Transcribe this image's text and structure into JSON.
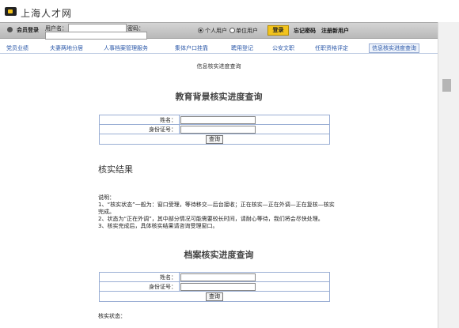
{
  "header": {
    "site_name": "上海人才网"
  },
  "login_bar": {
    "member_login": "会员登录",
    "username_label": "用户名：",
    "password_label": "密码：",
    "personal_user": "个人用户",
    "unit_user": "单位用户",
    "login_button": "登录",
    "forgot_password": "忘记密码",
    "register": "注册新用户",
    "selected_user_type": "个人用户"
  },
  "nav": {
    "items": [
      "党员业绩",
      "夫妻两地分居",
      "人事档案管理服务",
      "集体户口挂靠",
      "聘用登记",
      "公安文职",
      "任职资格评定",
      "信息核实进度查询"
    ]
  },
  "page": {
    "subtitle": "信息核实进度查询",
    "education_title": "教育背景核实进度查询",
    "archive_title": "档案核实进度查询",
    "result_title": "核实结果",
    "name_label": "姓名：",
    "id_label": "身份证号：",
    "query_button": "查询",
    "notes": [
      "说明：",
      "1、“核实状态”一般为：窗口受理，等待移交—后台接收；正在核实—正在外调—正在复核—核实完成。",
      "2、状态为“正在外调”，其中部分情况可能需要较长时间，请耐心等待，我们将会尽快处理。",
      "3、核实完成后，具体核实结果请咨询受理窗口。"
    ],
    "status_label": "核实状态："
  }
}
